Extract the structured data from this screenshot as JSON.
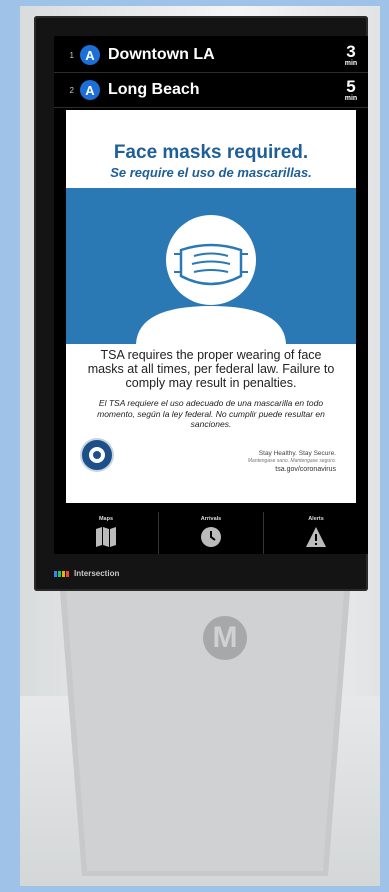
{
  "arrivals": [
    {
      "index": "1",
      "line": "A",
      "destination": "Downtown LA",
      "minutes": "3",
      "unit": "min"
    },
    {
      "index": "2",
      "line": "A",
      "destination": "Long Beach",
      "minutes": "5",
      "unit": "min"
    }
  ],
  "poster": {
    "title": "Face masks required.",
    "subtitle": "Se require el uso de mascarillas.",
    "body_en": "TSA requires the proper wearing of face masks at all times, per federal law. Failure to comply may result in penalties.",
    "body_es": "El TSA requiere el uso adecuado de una mascarilla en todo momento, según la ley federal. No cumplir puede resultar en sanciones.",
    "tagline": "Stay Healthy. Stay Secure.",
    "tagline_es": "Mantengase sano. Mantengase seguro.",
    "url": "tsa.gov/coronavirus"
  },
  "nav": {
    "maps": "Maps",
    "arrivals": "Arrivals",
    "alerts": "Alerts"
  },
  "brand": "Intersection",
  "pedestal_logo": "M",
  "colors": {
    "line_badge": "#1c6fd6",
    "poster_blue": "#2a79b5",
    "title_blue": "#1f5f97"
  }
}
